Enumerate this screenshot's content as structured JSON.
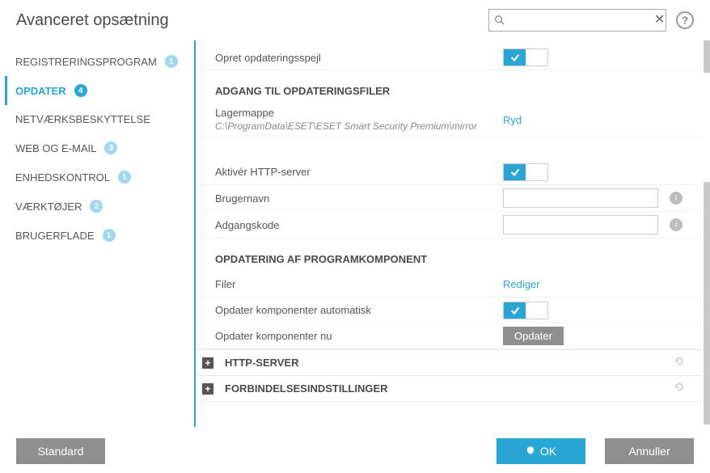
{
  "header": {
    "title": "Avanceret opsætning",
    "search_placeholder": "",
    "help_tooltip": "?"
  },
  "sidebar": {
    "items": [
      {
        "label": "REGISTRERINGSPROGRAM",
        "badge": "1",
        "active": false
      },
      {
        "label": "OPDATER",
        "badge": "4",
        "active": true
      },
      {
        "label": "NETVÆRKSBESKYTTELSE",
        "badge": "",
        "active": false
      },
      {
        "label": "WEB OG E-MAIL",
        "badge": "3",
        "active": false
      },
      {
        "label": "ENHEDSKONTROL",
        "badge": "1",
        "active": false
      },
      {
        "label": "VÆRKTØJER",
        "badge": "2",
        "active": false
      },
      {
        "label": "BRUGERFLADE",
        "badge": "1",
        "active": false
      }
    ]
  },
  "content": {
    "mirror_row": {
      "label": "Opret opdateringsspejl"
    },
    "section_storage": {
      "heading": "ADGANG TIL OPDATERINGSFILER",
      "folder_label": "Lagermappe",
      "folder_path": "C:\\ProgramData\\ESET\\ESET Smart Security Premium\\mirror",
      "clear_link": "Ryd",
      "http_enable_label": "Aktivér HTTP-server",
      "username_label": "Brugernavn",
      "username_value": "",
      "password_label": "Adgangskode",
      "password_value": ""
    },
    "section_component": {
      "heading": "OPDATERING AF PROGRAMKOMPONENT",
      "files_label": "Filer",
      "files_link": "Rediger",
      "auto_label": "Opdater komponenter automatisk",
      "now_label": "Opdater komponenter nu",
      "now_button": "Opdater"
    },
    "expanders": [
      {
        "label": "HTTP-SERVER"
      },
      {
        "label": "FORBINDELSESINDSTILLINGER"
      }
    ]
  },
  "footer": {
    "standard": "Standard",
    "ok": "OK",
    "cancel": "Annuller"
  }
}
